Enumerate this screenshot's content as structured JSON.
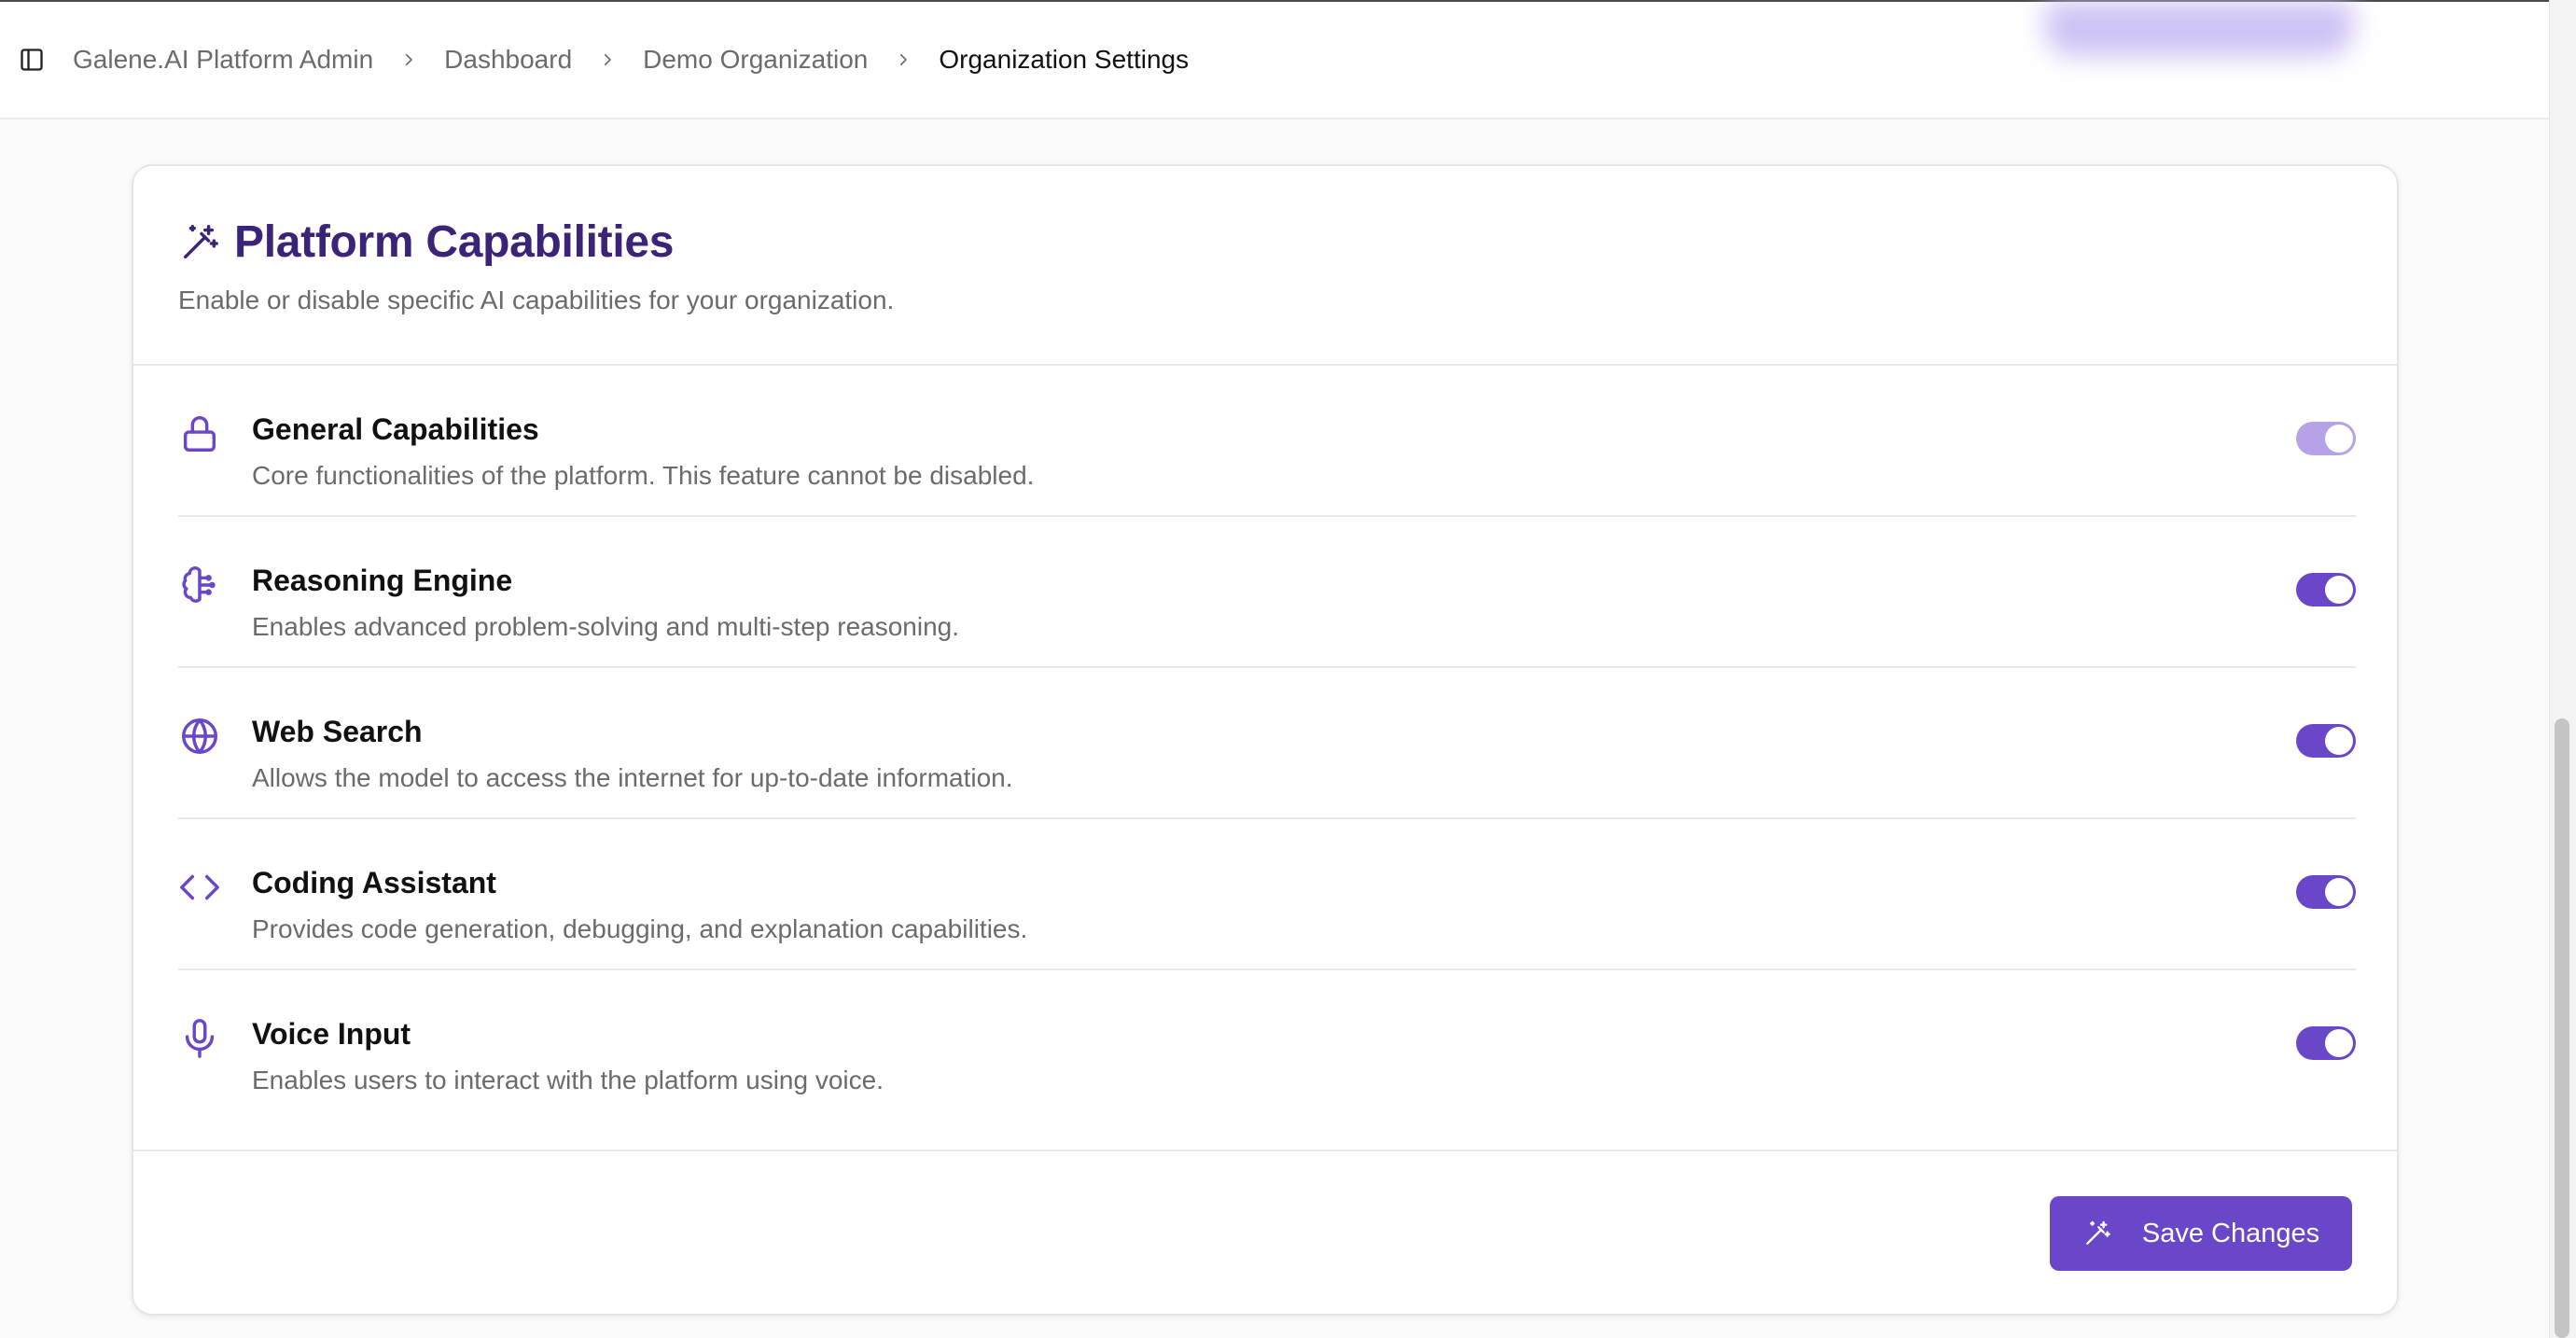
{
  "breadcrumb": {
    "items": [
      "Galene.AI Platform Admin",
      "Dashboard",
      "Demo Organization"
    ],
    "current": "Organization Settings"
  },
  "capabilities_card": {
    "title": "Platform Capabilities",
    "description": "Enable or disable specific AI capabilities for your organization.",
    "title_icon": "magic-wand-icon"
  },
  "capabilities": [
    {
      "title": "General Capabilities",
      "description": "Core functionalities of the platform. This feature cannot be disabled.",
      "icon": "lock-icon",
      "enabled": true,
      "disabled": true
    },
    {
      "title": "Reasoning Engine",
      "description": "Enables advanced problem-solving and multi-step reasoning.",
      "icon": "brain-icon",
      "enabled": true,
      "disabled": false
    },
    {
      "title": "Web Search",
      "description": "Allows the model to access the internet for up-to-date information.",
      "icon": "globe-icon",
      "enabled": true,
      "disabled": false
    },
    {
      "title": "Coding Assistant",
      "description": "Provides code generation, debugging, and explanation capabilities.",
      "icon": "code-icon",
      "enabled": true,
      "disabled": false
    },
    {
      "title": "Voice Input",
      "description": "Enables users to interact with the platform using voice.",
      "icon": "microphone-icon",
      "enabled": true,
      "disabled": false
    }
  ],
  "footer": {
    "save_label": "Save Changes",
    "save_icon": "magic-wand-icon"
  },
  "colors": {
    "accent": "#6a47c9",
    "accent_disabled": "#b6a2e6",
    "title": "#3b2377",
    "muted_text": "#6b6b6b"
  }
}
